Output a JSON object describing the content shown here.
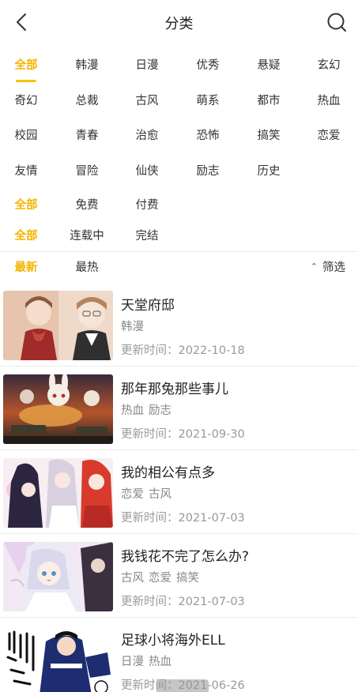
{
  "header": {
    "title": "分类",
    "back_icon": "back-icon",
    "search_icon": "search-icon"
  },
  "colors": {
    "accent": "#f5b400",
    "text": "#333333",
    "muted": "#999999"
  },
  "filters": {
    "genre": {
      "selected": "全部",
      "rows": [
        [
          "全部",
          "韩漫",
          "日漫",
          "优秀",
          "悬疑",
          "玄幻"
        ],
        [
          "奇幻",
          "总裁",
          "古风",
          "萌系",
          "都市",
          "热血"
        ],
        [
          "校园",
          "青春",
          "治愈",
          "恐怖",
          "搞笑",
          "恋爱"
        ],
        [
          "友情",
          "冒险",
          "仙侠",
          "励志",
          "历史"
        ]
      ]
    },
    "price": {
      "selected": "全部",
      "options": [
        "全部",
        "免费",
        "付费"
      ]
    },
    "status": {
      "selected": "全部",
      "options": [
        "全部",
        "连载中",
        "完结"
      ]
    }
  },
  "sort": {
    "selected": "最新",
    "options": [
      "最新",
      "最热"
    ],
    "filter_label": "筛选",
    "filter_icon": "chevron-up-icon"
  },
  "comics": [
    {
      "title": "天堂府邸",
      "tags": [
        "韩漫"
      ],
      "updated": "更新时间：2022-10-18"
    },
    {
      "title": "那年那兔那些事儿",
      "tags": [
        "热血",
        "励志"
      ],
      "updated": "更新时间：2021-09-30"
    },
    {
      "title": "我的相公有点多",
      "tags": [
        "恋爱",
        "古风"
      ],
      "updated": "更新时间：2021-07-03"
    },
    {
      "title": "我钱花不完了怎么办?",
      "tags": [
        "古风",
        "恋爱",
        "搞笑"
      ],
      "updated": "更新时间：2021-07-03"
    },
    {
      "title": "足球小将海外ELL",
      "tags": [
        "日漫",
        "热血"
      ],
      "updated": "更新时间：2021-06-26"
    }
  ]
}
